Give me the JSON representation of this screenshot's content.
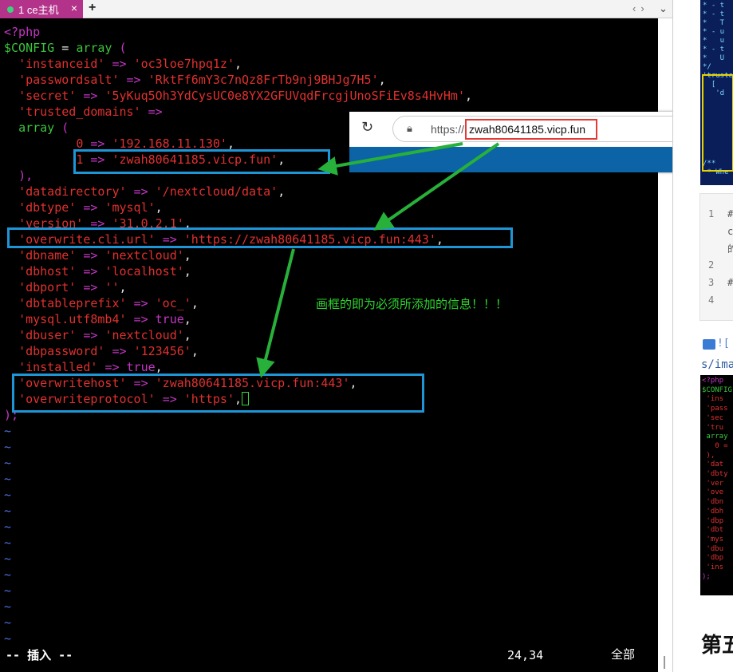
{
  "tabbar": {
    "tab_title": "1 ce主机",
    "close": "×",
    "add": "+",
    "nav": "‹›",
    "menu": "⌄"
  },
  "code": {
    "line1": "<?php",
    "cfg_var": "$CONFIG",
    "cfg_eq": " = ",
    "cfg_array": "array",
    "cfg_paren": " (",
    "instanceid_key": "'instanceid'",
    "instanceid_val": "'oc3loe7hpq1z'",
    "passwordsalt_key": "'passwordsalt'",
    "passwordsalt_val": "'RktFf6mY3c7nQz8FrTb9nj9BHJg7H5'",
    "secret_key": "'secret'",
    "secret_val": "'5yKuq5Oh3YdCysUC0e8YX2GFUVqdFrcgjUnoSFiEv8s4HvHm'",
    "trusted_key": "'trusted_domains'",
    "arrow": "=>",
    "comma": ",",
    "array_kw": "array",
    "open_paren": "(",
    "close_paren": "),",
    "td0_key": "0",
    "td0_val": "'192.168.11.130'",
    "td1_key": "1",
    "td1_val": "'zwah80641185.vicp.fun'",
    "datadirectory_key": "'datadirectory'",
    "datadirectory_val": "'/nextcloud/data'",
    "dbtype_key": "'dbtype'",
    "dbtype_val": "'mysql'",
    "version_key": "'version'",
    "version_val": "'31.0.2.1'",
    "overwrite_cli_key": "'overwrite.cli.url'",
    "overwrite_cli_val": "'https://zwah80641185.vicp.fun:443'",
    "dbname_key": "'dbname'",
    "dbname_val": "'nextcloud'",
    "dbhost_key": "'dbhost'",
    "dbhost_val": "'localhost'",
    "dbport_key": "'dbport'",
    "dbport_val": "''",
    "dbtableprefix_key": "'dbtableprefix'",
    "dbtableprefix_val": "'oc_'",
    "mysql_key": "'mysql.utf8mb4'",
    "true_kw": "true",
    "dbuser_key": "'dbuser'",
    "dbuser_val": "'nextcloud'",
    "dbpassword_key": "'dbpassword'",
    "dbpassword_val": "'123456'",
    "installed_key": "'installed'",
    "overwritehost_key": "'overwritehost'",
    "overwritehost_val": "'zwah80641185.vicp.fun:443'",
    "overwriteprotocol_key": "'overwriteprotocol'",
    "overwriteprotocol_val": "'https'",
    "end_line": ");",
    "tilde": "~"
  },
  "status": {
    "mode": "-- 插入 --",
    "position": "24,34",
    "scope": "全部"
  },
  "browser": {
    "scheme": "https://",
    "host": "zwah80641185.vicp.fun"
  },
  "annotation_text": "画框的即为必须所添加的信息！！！",
  "right_panel": {
    "snip1_lines": [
      "* - t",
      "* - t",
      "*   T",
      "* - u",
      "*   u",
      "* - t",
      "*   U",
      "*/",
      "'truste",
      "  [",
      "   'd",
      "",
      "",
      "",
      "",
      "",
      "",
      "",
      "/**",
      " * Whe"
    ],
    "gutter": [
      "1",
      "2",
      "3",
      "4"
    ],
    "gutter_text": [
      "#",
      "c",
      "的",
      "#"
    ],
    "img_link": "![",
    "img_path": "s/ima",
    "snip2_lines": [
      "<?php",
      "$CONFIG",
      " 'ins",
      " 'pass",
      " 'sec",
      " 'tru",
      " array",
      "   0 =",
      " ),",
      " 'dat",
      " 'dbty",
      " 'ver",
      " 'ove",
      " 'dbn",
      " 'dbh",
      " 'dbp",
      " 'dbt",
      " 'mys",
      " 'dbu",
      " 'dbp",
      " 'ins",
      ");"
    ],
    "heading": "第五"
  },
  "colors": {
    "keyword_purple": "#c436c4",
    "array_green": "#3cc33c",
    "string_red": "#e0312f",
    "box_blue": "#1e96d6",
    "arrow_green": "#27b03a",
    "url_box_red": "#e53935",
    "tab_magenta": "#b3328a"
  }
}
